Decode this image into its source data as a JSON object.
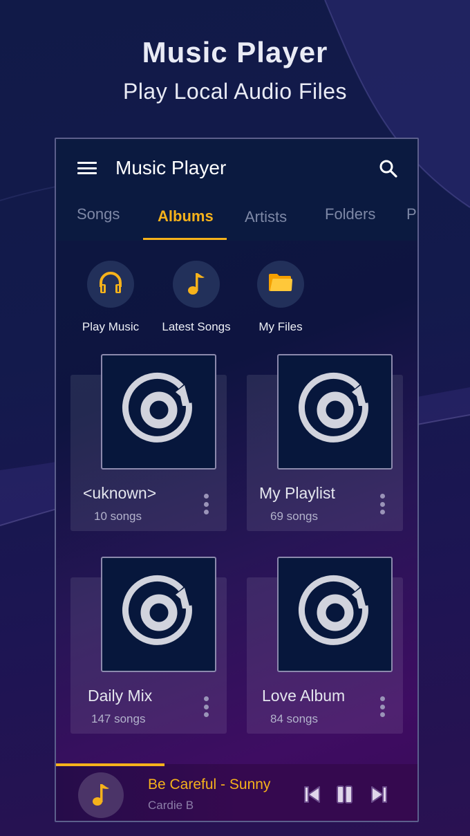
{
  "promo": {
    "title": "Music Player",
    "subtitle": "Play Local Audio Files"
  },
  "appbar": {
    "title": "Music Player",
    "menu_icon": "hamburger-menu-icon",
    "search_icon": "search-icon"
  },
  "tabs": [
    {
      "label": "Songs",
      "active": false
    },
    {
      "label": "Albums",
      "active": true
    },
    {
      "label": "Artists",
      "active": false
    },
    {
      "label": "Folders",
      "active": false
    },
    {
      "label": "P",
      "active": false
    }
  ],
  "quick_actions": [
    {
      "label": "Play Music",
      "icon": "headphones-icon"
    },
    {
      "label": "Latest Songs",
      "icon": "music-note-icon"
    },
    {
      "label": "My Files",
      "icon": "folder-icon"
    }
  ],
  "albums": [
    {
      "name": "<uknown>",
      "count": "10 songs",
      "icon": "album-disc-icon"
    },
    {
      "name": "My Playlist",
      "count": "69 songs",
      "icon": "album-disc-icon"
    },
    {
      "name": "Daily Mix",
      "count": "147 songs",
      "icon": "album-disc-icon"
    },
    {
      "name": "Love Album",
      "count": "84 songs",
      "icon": "album-disc-icon"
    }
  ],
  "now_playing": {
    "title": "Be Careful - Sunny",
    "artist": "Cardie B",
    "progress_fraction": 0.3,
    "controls": [
      "previous",
      "pause",
      "next"
    ]
  },
  "colors": {
    "accent": "#f6b21b",
    "appbar_bg": "#0b1a40",
    "tab_inactive": "#7e88a6",
    "cover_bg": "#07173c",
    "disc_icon": "#d1d3dd",
    "player_bg": "#35094f"
  }
}
